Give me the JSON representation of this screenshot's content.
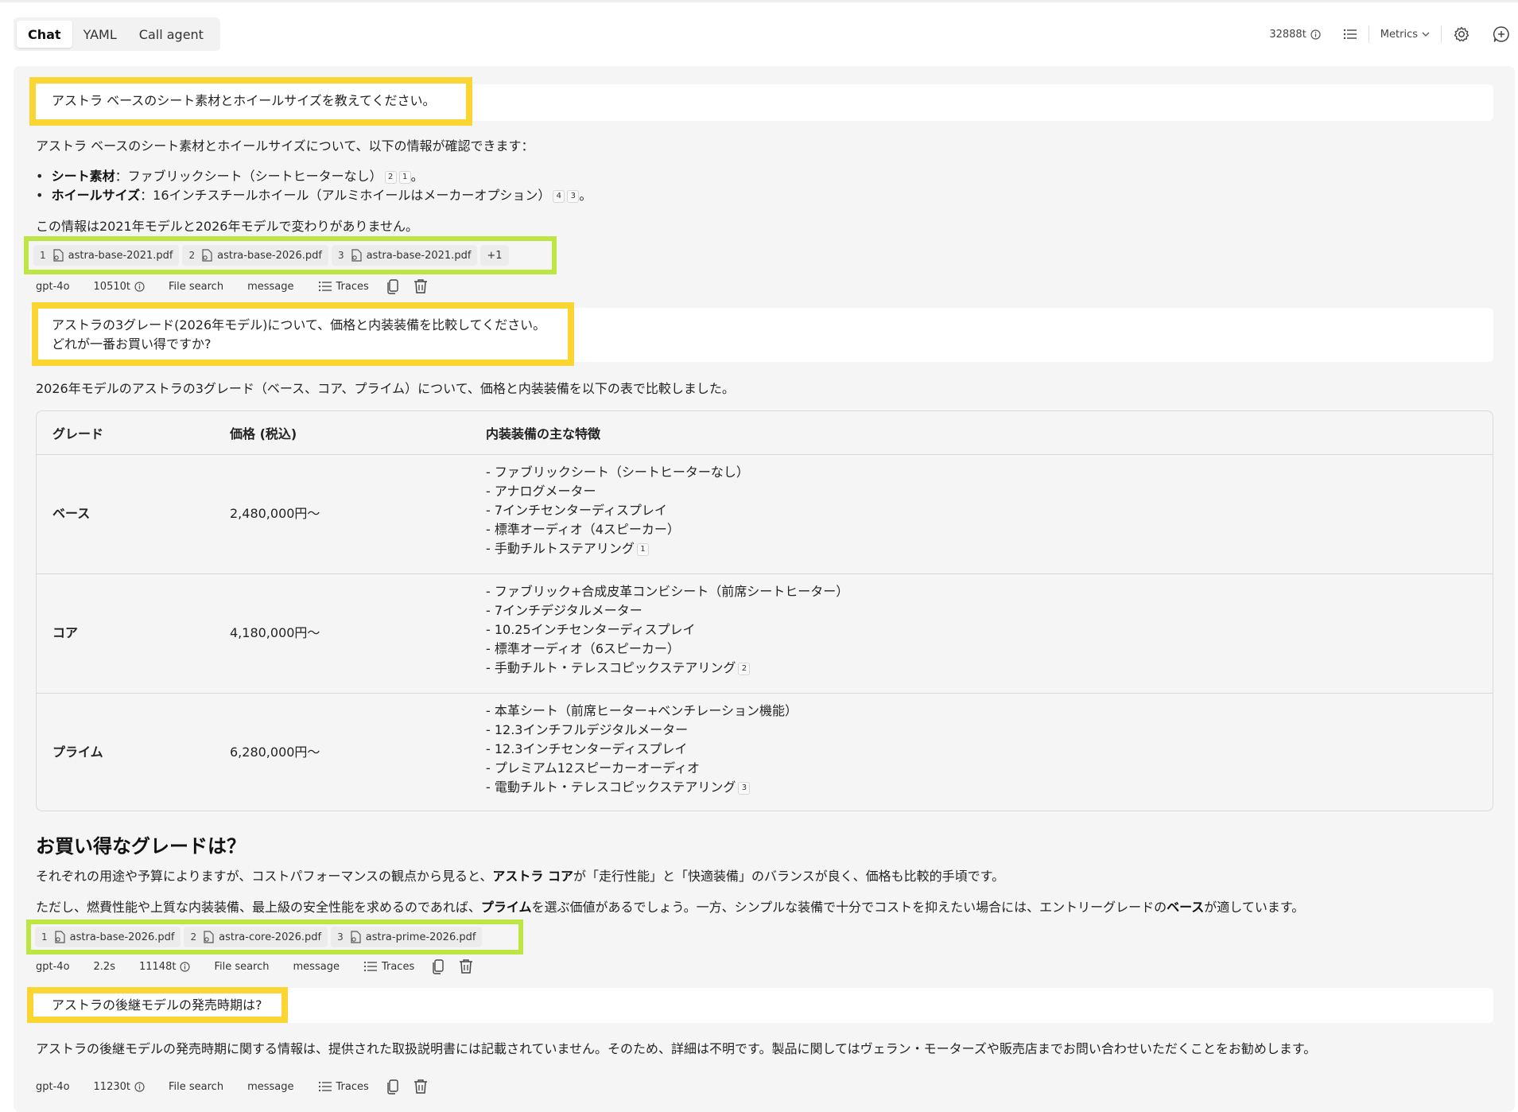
{
  "tabs": [
    "Chat",
    "YAML",
    "Call agent"
  ],
  "header": {
    "tokens": "32888t",
    "metrics_label": "Metrics"
  },
  "conversation": {
    "q1": "アストラ ベースのシート素材とホイールサイズを教えてください。",
    "a1": {
      "intro": "アストラ ベースのシート素材とホイールサイズについて、以下の情報が確認できます：",
      "bullet1_label": "シート素材",
      "bullet1_text": "：ファブリックシート（シートヒーターなし）",
      "bullet1_refs": [
        "2",
        "1"
      ],
      "bullet2_label": "ホイールサイズ",
      "bullet2_text": "：16インチスチールホイール（アルミホイールはメーカーオプション）",
      "bullet2_refs": [
        "4",
        "3"
      ],
      "end_punct": "。",
      "note": "この情報は2021年モデルと2026年モデルで変わりがありません。",
      "sources": [
        {
          "num": "1",
          "file": "astra-base-2021.pdf"
        },
        {
          "num": "2",
          "file": "astra-base-2026.pdf"
        },
        {
          "num": "3",
          "file": "astra-base-2021.pdf"
        }
      ],
      "sources_more": "+1",
      "meta": {
        "model": "gpt-4o",
        "tokens": "10510t",
        "tool": "File search",
        "type": "message",
        "traces": "Traces"
      }
    },
    "q2_line1": "アストラの3グレード(2026年モデル)について、価格と内装装備を比較してください。",
    "q2_line2": "どれが一番お買い得ですか?",
    "a2": {
      "intro": "2026年モデルのアストラの3グレード（ベース、コア、プライム）について、価格と内装装備を以下の表で比較しました。",
      "table": {
        "headers": [
          "グレード",
          "価格 (税込)",
          "内装装備の主な特徴"
        ],
        "rows": [
          {
            "grade": "ベース",
            "price": "2,480,000円～",
            "features": [
              "- ファブリックシート（シートヒーターなし）",
              "- アナログメーター",
              "- 7インチセンターディスプレイ",
              "- 標準オーディオ（4スピーカー）",
              "- 手動チルトステアリング"
            ],
            "ref": "1"
          },
          {
            "grade": "コア",
            "price": "4,180,000円～",
            "features": [
              "- ファブリック+合成皮革コンビシート（前席シートヒーター）",
              "- 7インチデジタルメーター",
              "- 10.25インチセンターディスプレイ",
              "- 標準オーディオ（6スピーカー）",
              "- 手動チルト・テレスコピックステアリング"
            ],
            "ref": "2"
          },
          {
            "grade": "プライム",
            "price": "6,280,000円～",
            "features": [
              "- 本革シート（前席ヒーター+ベンチレーション機能）",
              "- 12.3インチフルデジタルメーター",
              "- 12.3インチセンターディスプレイ",
              "- プレミアム12スピーカーオーディオ",
              "- 電動チルト・テレスコピックステアリング"
            ],
            "ref": "3"
          }
        ]
      },
      "heading": "お買い得なグレードは？",
      "p1_a": "それぞれの用途や予算によりますが、コストパフォーマンスの観点から見ると、",
      "p1_b": "アストラ コア",
      "p1_c": "が「走行性能」と「快適装備」のバランスが良く、価格も比較的手頃です。",
      "p2_a": "ただし、燃費性能や上質な内装装備、最上級の安全性能を求めるのであれば、",
      "p2_b": "プライム",
      "p2_c": "を選ぶ価値があるでしょう。一方、シンプルな装備で十分でコストを抑えたい場合には、エントリーグレードの",
      "p2_d": "ベース",
      "p2_e": "が適しています。",
      "sources": [
        {
          "num": "1",
          "file": "astra-base-2026.pdf"
        },
        {
          "num": "2",
          "file": "astra-core-2026.pdf"
        },
        {
          "num": "3",
          "file": "astra-prime-2026.pdf"
        }
      ],
      "meta": {
        "model": "gpt-4o",
        "time": "2.2s",
        "tokens": "11148t",
        "tool": "File search",
        "type": "message",
        "traces": "Traces"
      }
    },
    "q3": "アストラの後継モデルの発売時期は?",
    "a3": {
      "text": "アストラの後継モデルの発売時期に関する情報は、提供された取扱説明書には記載されていません。そのため、詳細は不明です。製品に関してはヴェラン・モーターズや販売店までお問い合わせいただくことをお勧めします。",
      "meta": {
        "model": "gpt-4o",
        "tokens": "11230t",
        "tool": "File search",
        "type": "message",
        "traces": "Traces"
      }
    }
  },
  "colors": {
    "highlight_yellow": "#fbd531",
    "highlight_green": "#bde645",
    "panel": "#f5f5f5"
  }
}
